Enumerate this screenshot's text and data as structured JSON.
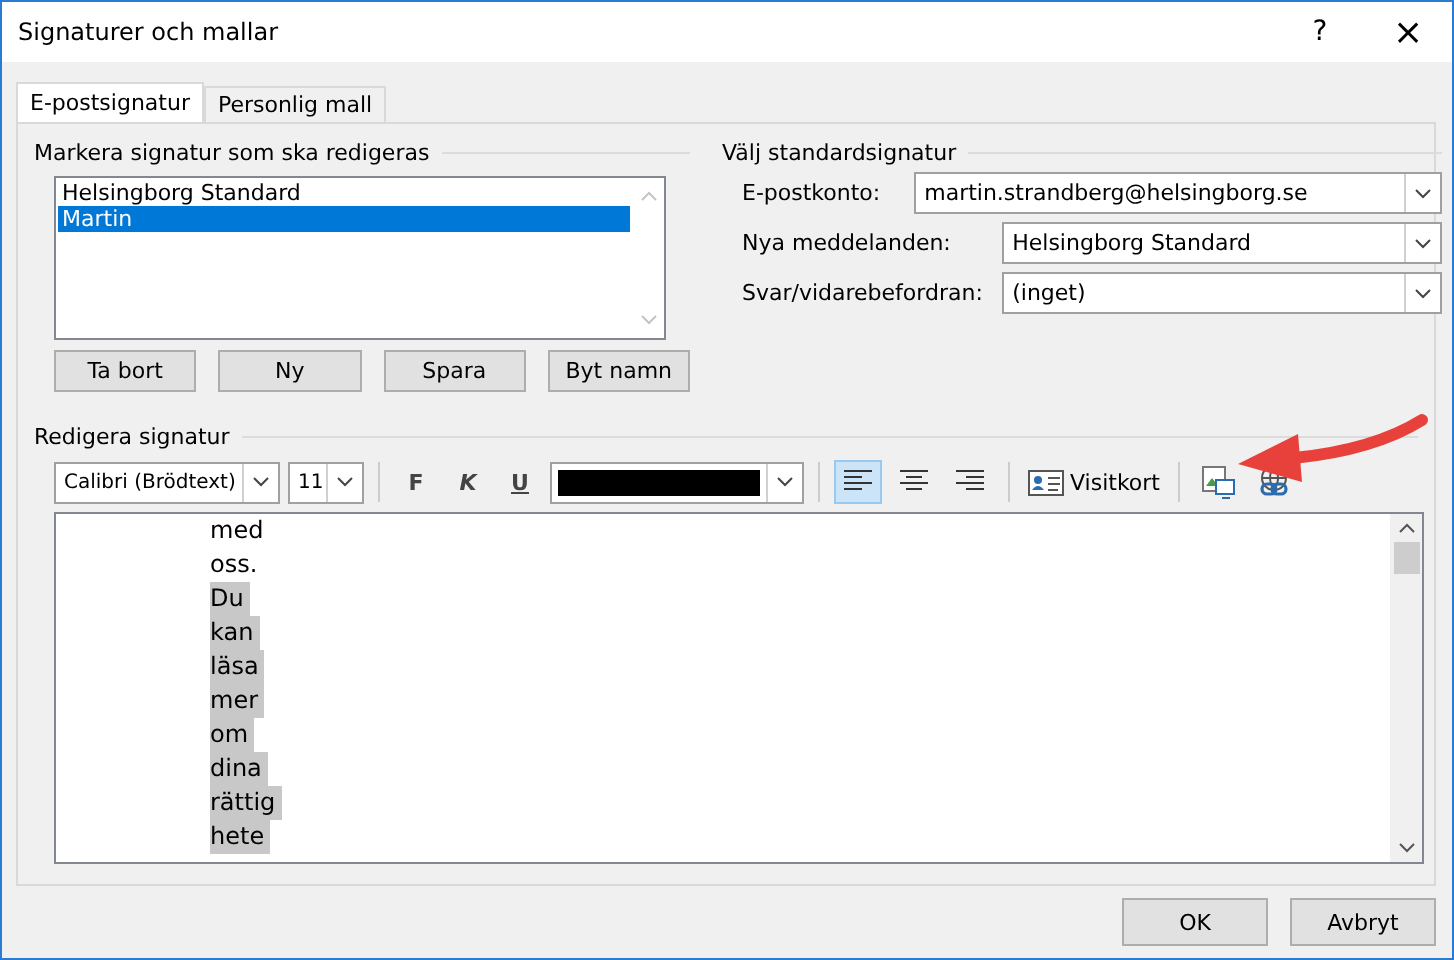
{
  "window": {
    "title": "Signaturer och mallar",
    "help": "?",
    "close": "×"
  },
  "tabs": [
    {
      "label": "E-postsignatur",
      "selected": true
    },
    {
      "label": "Personlig mall",
      "selected": false
    }
  ],
  "signature_list": {
    "label": "Markera signatur som ska redigeras",
    "items": [
      {
        "label": "Helsingborg Standard",
        "selected": false
      },
      {
        "label": "Martin",
        "selected": true
      }
    ],
    "buttons": [
      "Ta bort",
      "Ny",
      "Spara",
      "Byt namn"
    ]
  },
  "default_signature": {
    "label": "Välj standardsignatur",
    "fields": [
      {
        "label": "E-postkonto:",
        "value": "martin.strandberg@helsingborg.se"
      },
      {
        "label": "Nya meddelanden:",
        "value": "Helsingborg Standard"
      },
      {
        "label": "Svar/vidarebefordran:",
        "value": "(inget)"
      }
    ]
  },
  "editor": {
    "label": "Redigera signatur",
    "font": "Calibri (Brödtext)",
    "size": "11",
    "bold": "F",
    "italic": "K",
    "underline": "U",
    "alignments": [
      {
        "kind": "left",
        "selected": true
      },
      {
        "kind": "center",
        "selected": false
      },
      {
        "kind": "right",
        "selected": false
      }
    ],
    "business_card": "Visitkort",
    "lines": [
      {
        "text": "med",
        "highlighted": false
      },
      {
        "text": "oss.",
        "highlighted": false
      },
      {
        "text": "Du",
        "highlighted": true
      },
      {
        "text": "kan",
        "highlighted": true
      },
      {
        "text": "läsa",
        "highlighted": true
      },
      {
        "text": "mer",
        "highlighted": true
      },
      {
        "text": "om",
        "highlighted": true
      },
      {
        "text": "dina",
        "highlighted": true
      },
      {
        "text": "rättig",
        "highlighted": true
      },
      {
        "text": "hete",
        "highlighted": true
      }
    ]
  },
  "buttons": [
    "OK",
    "Avbryt"
  ]
}
